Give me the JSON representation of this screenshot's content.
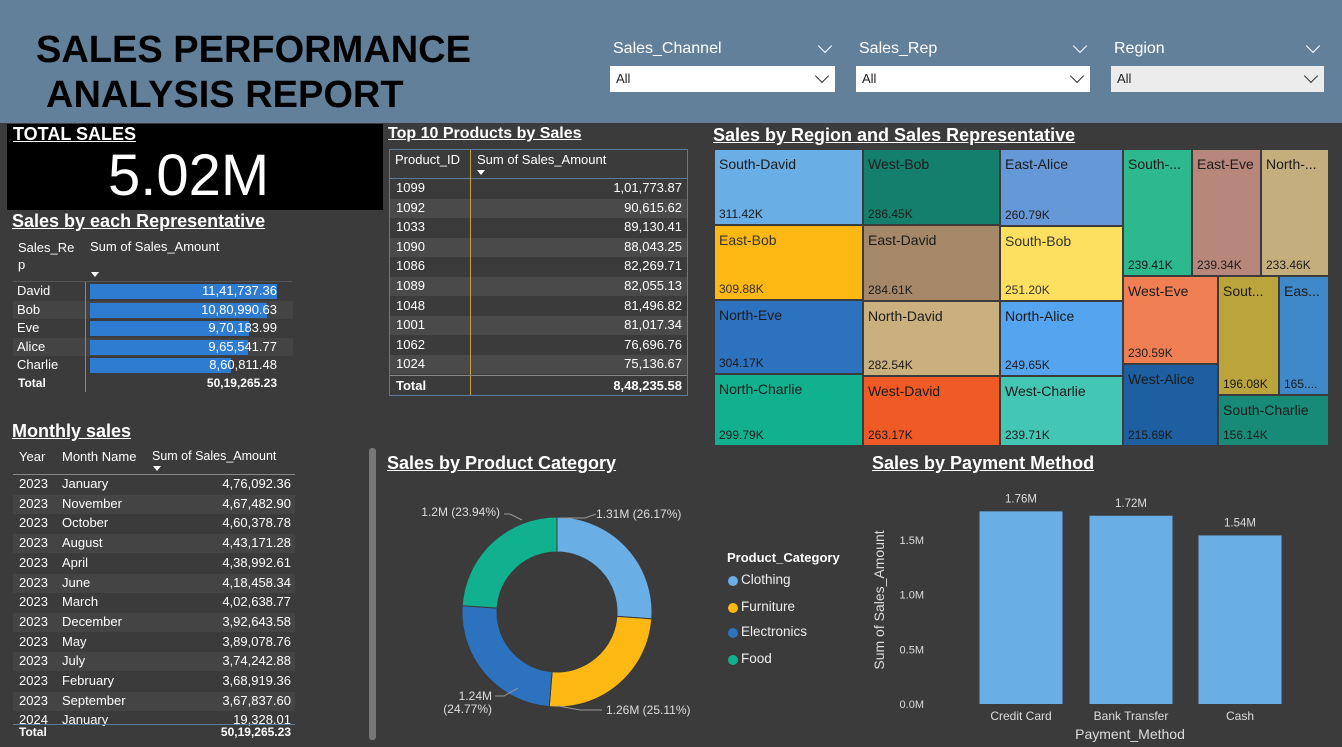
{
  "header": {
    "title_line1": "SALES PERFORMANCE",
    "title_line2": "ANALYSIS REPORT",
    "slicers": [
      {
        "label": "Sales_Channel",
        "value": "All"
      },
      {
        "label": "Sales_Rep",
        "value": "All"
      },
      {
        "label": "Region",
        "value": "All"
      }
    ]
  },
  "kpi": {
    "title": "TOTAL SALES",
    "value": "5.02M"
  },
  "rep_table": {
    "title": "Sales by each Representative",
    "col1_line1": "Sales_Re",
    "col1_line2": "p",
    "col2": "Sum of Sales_Amount",
    "rows": [
      {
        "name": "David",
        "amount": "11,41,737.36",
        "fraction": 1.0
      },
      {
        "name": "Bob",
        "amount": "10,80,990.63",
        "fraction": 0.947
      },
      {
        "name": "Eve",
        "amount": "9,70,183.99",
        "fraction": 0.85
      },
      {
        "name": "Alice",
        "amount": "9,65,541.77",
        "fraction": 0.846
      },
      {
        "name": "Charlie",
        "amount": "8,60,811.48",
        "fraction": 0.754
      }
    ],
    "total_label": "Total",
    "total_value": "50,19,265.23",
    "bar_color": "#2e7cd1"
  },
  "top_products": {
    "title": "Top 10 Products by Sales",
    "col1": "Product_ID",
    "col2": "Sum of Sales_Amount",
    "rows": [
      {
        "id": "1099",
        "amount": "1,01,773.87"
      },
      {
        "id": "1092",
        "amount": "90,615.62"
      },
      {
        "id": "1033",
        "amount": "89,130.41"
      },
      {
        "id": "1090",
        "amount": "88,043.25"
      },
      {
        "id": "1086",
        "amount": "82,269.71"
      },
      {
        "id": "1089",
        "amount": "82,055.13"
      },
      {
        "id": "1048",
        "amount": "81,496.82"
      },
      {
        "id": "1001",
        "amount": "81,017.34"
      },
      {
        "id": "1062",
        "amount": "76,696.76"
      },
      {
        "id": "1024",
        "amount": "75,136.67"
      }
    ],
    "total_label": "Total",
    "total_value": "8,48,235.58"
  },
  "monthly": {
    "title": "Monthly sales",
    "col1": "Year",
    "col2": "Month Name",
    "col3": "Sum of Sales_Amount",
    "rows": [
      {
        "year": "2023",
        "month": "January",
        "amount": "4,76,092.36"
      },
      {
        "year": "2023",
        "month": "November",
        "amount": "4,67,482.90"
      },
      {
        "year": "2023",
        "month": "October",
        "amount": "4,60,378.78"
      },
      {
        "year": "2023",
        "month": "August",
        "amount": "4,43,171.28"
      },
      {
        "year": "2023",
        "month": "April",
        "amount": "4,38,992.61"
      },
      {
        "year": "2023",
        "month": "June",
        "amount": "4,18,458.34"
      },
      {
        "year": "2023",
        "month": "March",
        "amount": "4,02,638.77"
      },
      {
        "year": "2023",
        "month": "December",
        "amount": "3,92,643.58"
      },
      {
        "year": "2023",
        "month": "May",
        "amount": "3,89,078.76"
      },
      {
        "year": "2023",
        "month": "July",
        "amount": "3,74,242.88"
      },
      {
        "year": "2023",
        "month": "February",
        "amount": "3,68,919.36"
      },
      {
        "year": "2023",
        "month": "September",
        "amount": "3,67,837.60"
      },
      {
        "year": "2024",
        "month": "January",
        "amount": "19,328.01"
      }
    ],
    "total_label": "Total",
    "total_value": "50,19,265.23"
  },
  "treemap": {
    "title": "Sales by Region and Sales Representative",
    "tiles": [
      {
        "label": "South-David",
        "value": "311.42K",
        "color": "#6aaee6"
      },
      {
        "label": "East-Bob",
        "value": "309.88K",
        "color": "#fdb813"
      },
      {
        "label": "North-Eve",
        "value": "304.17K",
        "color": "#2d72bf"
      },
      {
        "label": "North-Charlie",
        "value": "299.79K",
        "color": "#11b08f"
      },
      {
        "label": "West-Bob",
        "value": "286.45K",
        "color": "#147f6c"
      },
      {
        "label": "East-David",
        "value": "284.61K",
        "color": "#a58868"
      },
      {
        "label": "North-David",
        "value": "282.54K",
        "color": "#c9b07e"
      },
      {
        "label": "West-David",
        "value": "263.17K",
        "color": "#ef5a26"
      },
      {
        "label": "East-Alice",
        "value": "260.79K",
        "color": "#6598d6"
      },
      {
        "label": "South-Bob",
        "value": "251.20K",
        "color": "#fee060"
      },
      {
        "label": "North-Alice",
        "value": "249.65K",
        "color": "#54a4f0"
      },
      {
        "label": "West-Charlie",
        "value": "239.71K",
        "color": "#44c6b4"
      },
      {
        "label": "South-...",
        "value": "239.41K",
        "color": "#2db88d"
      },
      {
        "label": "East-Eve",
        "value": "239.34K",
        "color": "#b8877c"
      },
      {
        "label": "North-...",
        "value": "233.46K",
        "color": "#c5ae7e"
      },
      {
        "label": "West-Eve",
        "value": "230.59K",
        "color": "#f08054"
      },
      {
        "label": "Sout...",
        "value": "196.08K",
        "color": "#bba43c"
      },
      {
        "label": "Eas...",
        "value": "165....",
        "color": "#3f88c9"
      },
      {
        "label": "West-Alice",
        "value": "215.69K",
        "color": "#1d5fa0"
      },
      {
        "label": "South-Charlie",
        "value": "156.14K",
        "color": "#178a78"
      }
    ]
  },
  "chart_data": [
    {
      "type": "pie",
      "title": "Sales by Product Category",
      "legend_title": "Product_Category",
      "legend_position": "right",
      "categories": [
        "Clothing",
        "Furniture",
        "Electronics",
        "Food"
      ],
      "values": [
        1.31,
        1.26,
        1.24,
        1.2
      ],
      "percents": [
        26.17,
        25.11,
        24.77,
        23.94
      ],
      "labels": [
        "1.31M (26.17%)",
        "1.26M (25.11%)",
        "1.24M",
        "1.2M (23.94%)"
      ],
      "label_extra": [
        "",
        "",
        "(24.77%)",
        ""
      ],
      "colors": [
        "#6aaee6",
        "#fdb813",
        "#2d72bf",
        "#11b08f"
      ]
    },
    {
      "type": "bar",
      "title": "Sales by Payment Method",
      "categories": [
        "Credit Card",
        "Bank Transfer",
        "Cash"
      ],
      "values": [
        1.76,
        1.72,
        1.54
      ],
      "data_labels": [
        "1.76M",
        "1.72M",
        "1.54M"
      ],
      "xlabel": "Payment_Method",
      "ylabel": "Sum of Sales_Amount",
      "ylim": [
        0,
        1.8
      ],
      "yticks": [
        0,
        0.5,
        1.0,
        1.5
      ],
      "ytick_labels": [
        "0.0M",
        "0.5M",
        "1.0M",
        "1.5M"
      ],
      "color": "#6aaee6",
      "grid": false
    }
  ]
}
